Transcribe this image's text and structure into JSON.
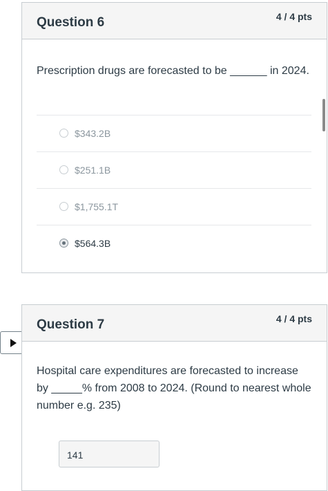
{
  "question6": {
    "title": "Question 6",
    "points": "4 / 4 pts",
    "text": "Prescription drugs are forecasted to be ______ in 2024.",
    "options": [
      "$343.2B",
      "$251.1B",
      "$1,755.1T",
      "$564.3B"
    ],
    "selected_option": "$564.3B"
  },
  "question7": {
    "title": "Question 7",
    "points": "4 / 4 pts",
    "text": "Hospital care expenditures are forecasted to increase by _____% from 2008 to 2024. (Round to nearest whole number e.g. 235)",
    "answer": "141"
  },
  "icons": {
    "flag_toggle": "play-triangle-icon"
  }
}
